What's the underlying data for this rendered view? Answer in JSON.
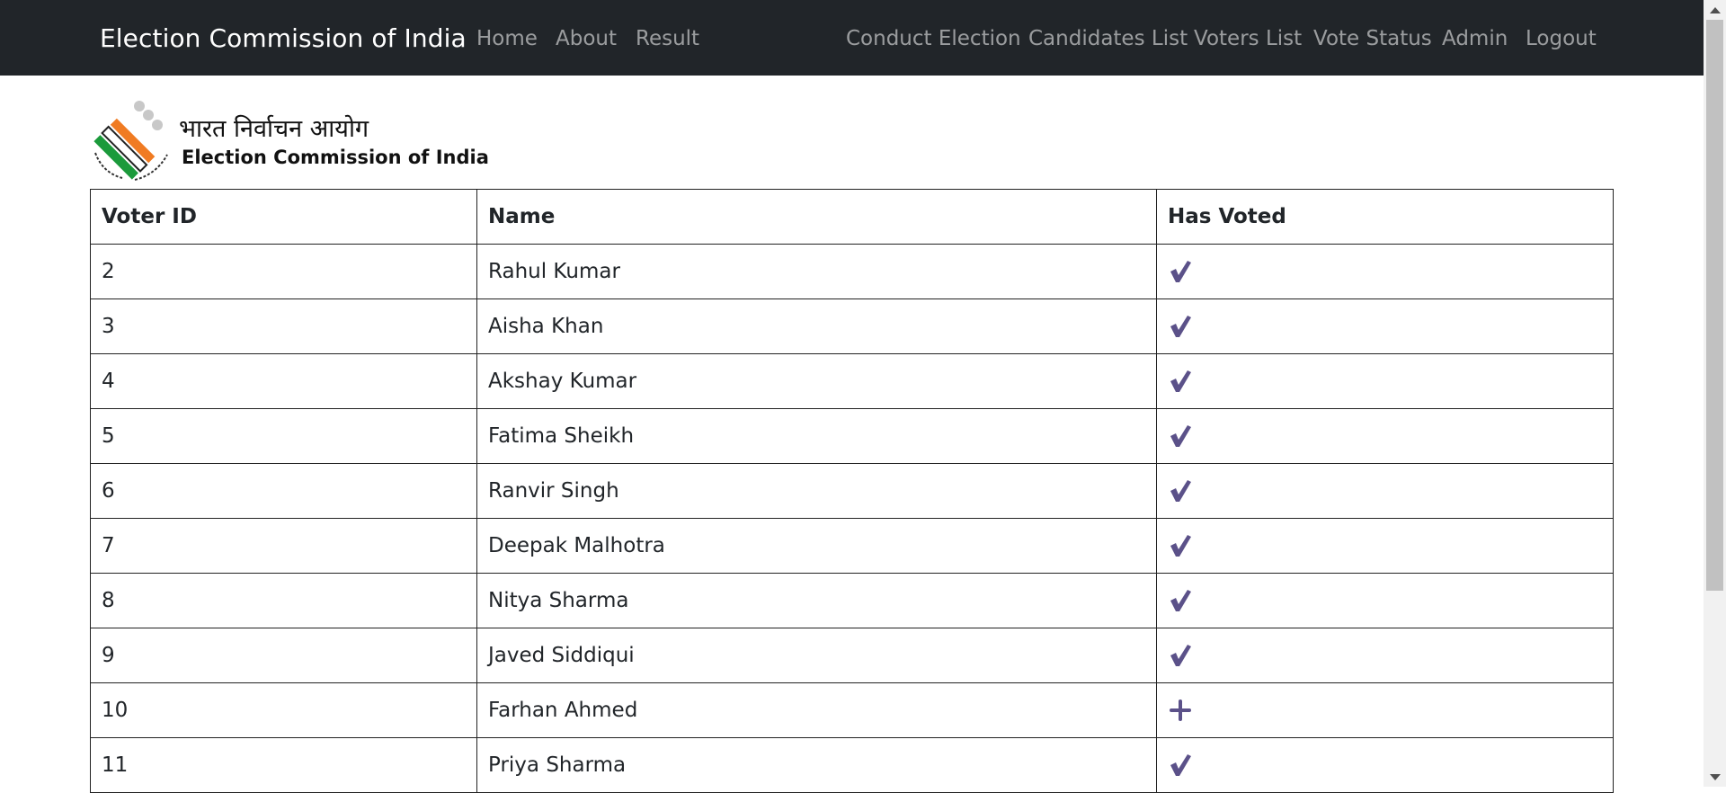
{
  "navbar": {
    "brand": "Election Commission of India",
    "left_links": [
      "Home",
      "About",
      "Result"
    ],
    "right_links": [
      "Conduct Election",
      "Candidates List",
      "Voters List",
      "Vote Status",
      "Admin",
      "Logout"
    ]
  },
  "logo": {
    "hindi": "भारत निर्वाचन आयोग",
    "english": "Election Commission of India"
  },
  "table": {
    "headers": [
      "Voter ID",
      "Name",
      "Has Voted"
    ],
    "rows": [
      {
        "id": "2",
        "name": "Rahul Kumar",
        "status_icon": "check-icon"
      },
      {
        "id": "3",
        "name": "Aisha Khan",
        "status_icon": "check-icon"
      },
      {
        "id": "4",
        "name": "Akshay Kumar",
        "status_icon": "check-icon"
      },
      {
        "id": "5",
        "name": "Fatima Sheikh",
        "status_icon": "check-icon"
      },
      {
        "id": "6",
        "name": "Ranvir Singh",
        "status_icon": "check-icon"
      },
      {
        "id": "7",
        "name": "Deepak Malhotra",
        "status_icon": "check-icon"
      },
      {
        "id": "8",
        "name": "Nitya Sharma",
        "status_icon": "check-icon"
      },
      {
        "id": "9",
        "name": "Javed Siddiqui",
        "status_icon": "check-icon"
      },
      {
        "id": "10",
        "name": "Farhan Ahmed",
        "status_icon": "plus-icon"
      },
      {
        "id": "11",
        "name": "Priya Sharma",
        "status_icon": "check-icon"
      }
    ]
  },
  "colors": {
    "navbar_bg": "#212529",
    "icon_purple": "#5b5189",
    "logo_orange": "#f07b22",
    "logo_green": "#1b9a3b"
  }
}
